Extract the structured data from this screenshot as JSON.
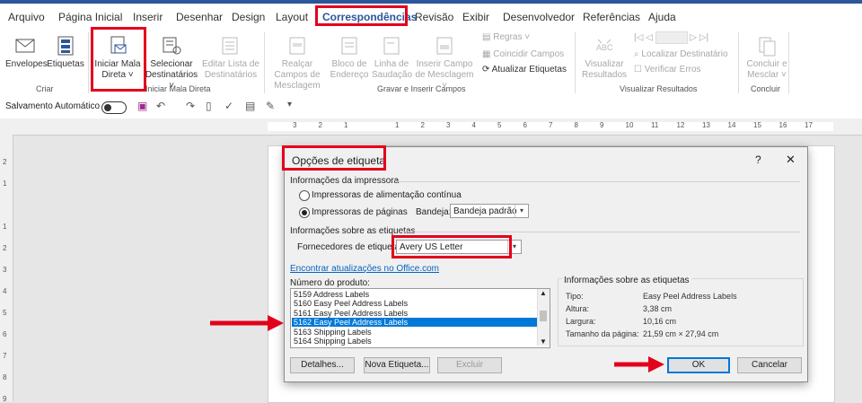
{
  "ribbon_tabs": [
    "Arquivo",
    "Página Inicial",
    "Inserir",
    "Desenhar",
    "Design",
    "Layout",
    "Correspondências",
    "Revisão",
    "Exibir",
    "Desenvolvedor",
    "Referências",
    "Ajuda"
  ],
  "ribbon": {
    "envelopes": "Envelopes",
    "etiquetas": "Etiquetas",
    "iniciar_mala_direta": "Iniciar Mala Direta",
    "selecionar_destinatarios": "Selecionar Destinatários",
    "editar_lista": "Editar Lista de Destinatários",
    "realcar_campos": "Realçar Campos de Mesclagem",
    "bloco_endereco": "Bloco de Endereço",
    "linha_saudacao": "Linha de Saudação",
    "inserir_campo": "Inserir Campo de Mesclagem",
    "regras": "Regras",
    "coincidir_campos": "Coincidir Campos",
    "atualizar_etiquetas": "Atualizar Etiquetas",
    "visualizar_resultados": "Visualizar Resultados",
    "localizar_destinatario": "Localizar Destinatário",
    "verificar_erros": "Verificar Erros",
    "concluir_mesclar": "Concluir e Mesclar",
    "groups": {
      "criar": "Criar",
      "iniciar": "Iniciar Mala Direta",
      "gravar": "Gravar e Inserir Campos",
      "visualizar": "Visualizar Resultados",
      "concluir": "Concluir"
    }
  },
  "qat": {
    "autosave": "Salvamento Automático"
  },
  "ruler_numbers": [
    "3",
    "2",
    "1",
    "",
    "1",
    "2",
    "3",
    "4",
    "5",
    "6",
    "7",
    "8",
    "9",
    "10",
    "11",
    "12",
    "13",
    "14",
    "15",
    "16",
    "17"
  ],
  "vruler_numbers": [
    "2",
    "1",
    "",
    "1",
    "2",
    "3",
    "4",
    "5",
    "6",
    "7",
    "8",
    "9"
  ],
  "dialog": {
    "title": "Opções de etiqueta",
    "help": "?",
    "close": "✕",
    "printer_info": "Informações da impressora",
    "continuous": "Impressoras de alimentação contínua",
    "page_printers": "Impressoras de páginas",
    "tray_label": "Bandeja:",
    "tray_value": "Bandeja padrão",
    "label_info_header": "Informações sobre as etiquetas",
    "vendor_label": "Fornecedores de etiquetas:",
    "vendor_value": "Avery US Letter",
    "updates_link": "Encontrar atualizações no Office.com",
    "product_number_label": "Número do produto:",
    "products": [
      "5159 Address Labels",
      "5160 Easy Peel Address Labels",
      "5161 Easy Peel Address Labels",
      "5162 Easy Peel Address Labels",
      "5163 Shipping Labels",
      "5164 Shipping Labels"
    ],
    "selected_product_index": 3,
    "label_details_title": "Informações sobre as etiquetas",
    "details": [
      {
        "key": "Tipo:",
        "value": "Easy Peel Address Labels"
      },
      {
        "key": "Altura:",
        "value": "3,38 cm"
      },
      {
        "key": "Largura:",
        "value": "10,16 cm"
      },
      {
        "key": "Tamanho da página:",
        "value": "21,59 cm × 27,94 cm"
      }
    ],
    "buttons": {
      "details": "Detalhes...",
      "new_label": "Nova Etiqueta...",
      "delete": "Excluir",
      "ok": "OK",
      "cancel": "Cancelar"
    }
  },
  "colors": {
    "accent": "#2b579a",
    "highlight_red": "#e3001b",
    "selection": "#0078d7"
  }
}
